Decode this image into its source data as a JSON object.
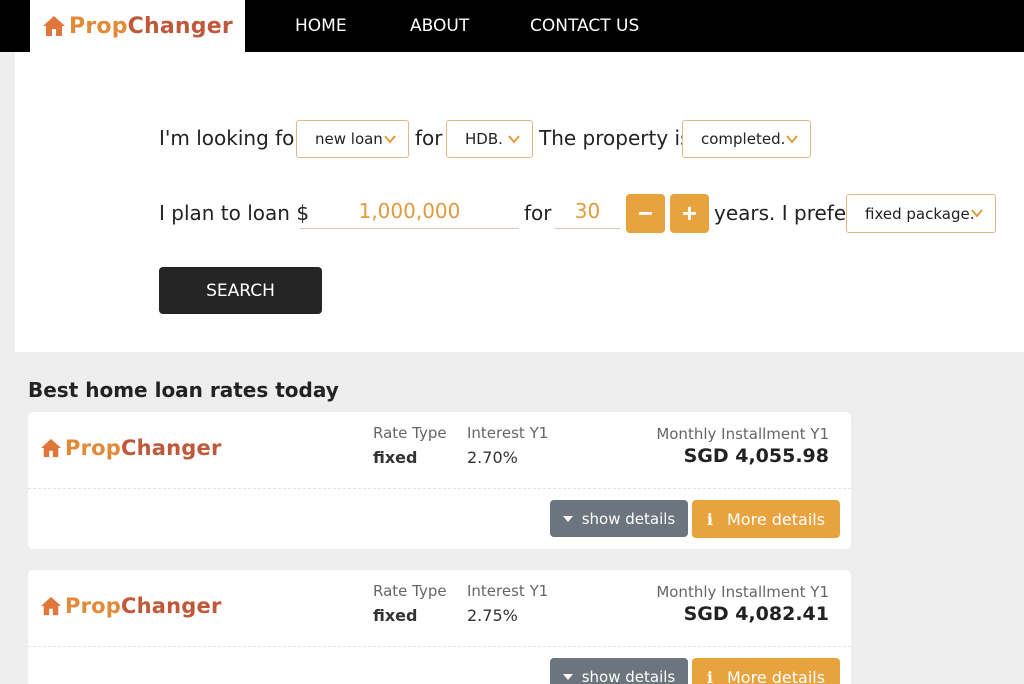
{
  "brand": {
    "word1": "Prop",
    "word2": "Changer"
  },
  "nav": {
    "home": "HOME",
    "about": "ABOUT",
    "contact": "CONTACT US"
  },
  "search": {
    "looking_for_label": "I'm looking for",
    "loan_type": "new loan",
    "for_label": "for",
    "property_type": "HDB.",
    "property_is_label": "The property is",
    "property_status": "completed.",
    "plan_label": "I plan to loan $",
    "amount": "1,000,000",
    "for_label2": "for",
    "years": "30",
    "minus": "−",
    "plus": "+",
    "prefer_label": "years. I prefer",
    "package": "fixed package.",
    "button": "SEARCH"
  },
  "section_title": "Best home loan rates today",
  "columns": {
    "rate_type": "Rate Type",
    "interest": "Interest Y1",
    "installment": "Monthly Installment Y1"
  },
  "results": [
    {
      "rate_type": "fixed",
      "interest": "2.70%",
      "installment": "SGD 4,055.98",
      "show_label": "show details",
      "more_label": "More details",
      "info_glyph": "i"
    },
    {
      "rate_type": "fixed",
      "interest": "2.75%",
      "installment": "SGD 4,082.41",
      "show_label": "show details",
      "more_label": "More details",
      "info_glyph": "i"
    }
  ],
  "colors": {
    "accent": "#e8a23e",
    "brand_orange": "#e08a3a",
    "brand_red": "#c0583a",
    "dark": "#252525",
    "gray_button": "#6c757d"
  },
  "icons": [
    "house-logo-icon",
    "chevron-down-icon",
    "caret-down-icon",
    "info-icon"
  ]
}
